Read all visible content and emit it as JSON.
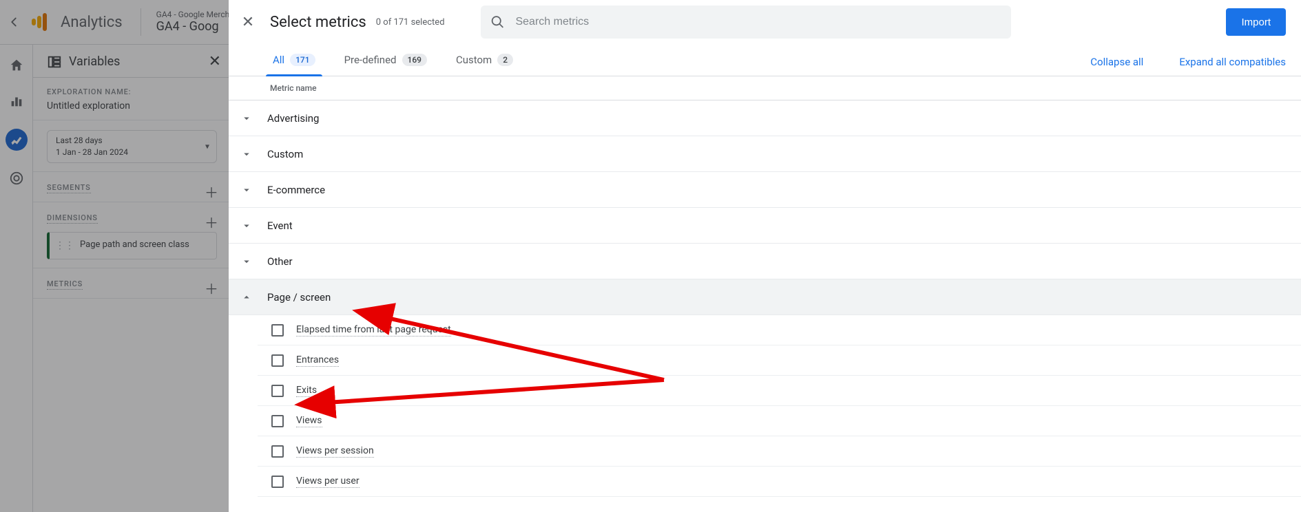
{
  "topbar": {
    "title": "Analytics",
    "property_sub": "GA4 - Google Merch",
    "property_main": "GA4 - Goog"
  },
  "variables": {
    "panel_title": "Variables",
    "exploration_label": "EXPLORATION NAME:",
    "exploration_value": "Untitled exploration",
    "date_preset": "Last 28 days",
    "date_range": "1 Jan - 28 Jan 2024",
    "segments_label": "SEGMENTS",
    "dimensions_label": "DIMENSIONS",
    "dimension_chip": "Page path and screen class",
    "metrics_label": "METRICS"
  },
  "overlay": {
    "title": "Select metrics",
    "subtitle": "0 of 171 selected",
    "search_placeholder": "Search metrics",
    "import_label": "Import",
    "tabs": {
      "all": {
        "label": "All",
        "count": "171"
      },
      "predefined": {
        "label": "Pre-defined",
        "count": "169"
      },
      "custom": {
        "label": "Custom",
        "count": "2"
      }
    },
    "collapse_label": "Collapse all",
    "expand_label": "Expand all compatibles",
    "column_header": "Metric name",
    "groups": {
      "advertising": "Advertising",
      "custom": "Custom",
      "ecommerce": "E-commerce",
      "event": "Event",
      "other": "Other",
      "page_screen": "Page / screen"
    },
    "page_screen_items": {
      "elapsed": "Elapsed time from last page request",
      "entrances": "Entrances",
      "exits": "Exits",
      "views": "Views",
      "views_per_session": "Views per session",
      "views_per_user": "Views per user"
    }
  }
}
